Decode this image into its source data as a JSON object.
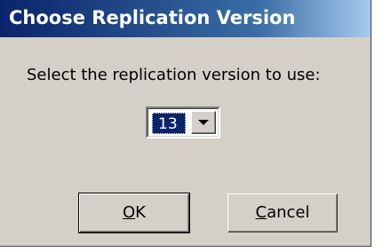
{
  "dialog": {
    "title": "Choose Replication Version",
    "prompt": "Select the replication version to use:"
  },
  "version_select": {
    "value": "13"
  },
  "buttons": {
    "ok_mnemonic": "O",
    "ok_rest": "K",
    "cancel_mnemonic": "C",
    "cancel_rest": "ancel"
  },
  "colors": {
    "title_bar_start": "#0a246a",
    "title_bar_end": "#a6caf0",
    "dialog_face": "#d4d0c8",
    "selection": "#0a246a"
  }
}
